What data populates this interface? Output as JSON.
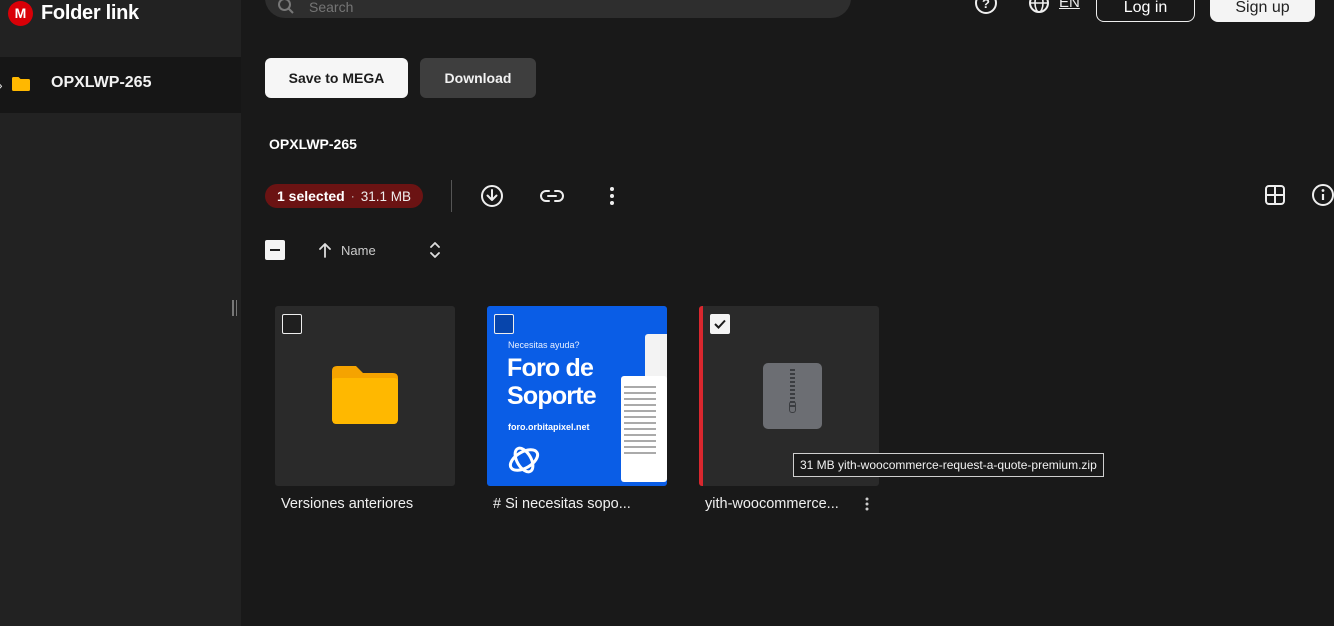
{
  "app": {
    "title": "Folder link"
  },
  "sidebar": {
    "items": [
      {
        "label": "OPXLWP-265"
      }
    ]
  },
  "search": {
    "placeholder": "Search"
  },
  "header": {
    "language": "EN",
    "login_label": "Log in",
    "signup_label": "Sign up"
  },
  "actions": {
    "save_label": "Save to MEGA",
    "download_label": "Download"
  },
  "folder": {
    "title": "OPXLWP-265"
  },
  "selection": {
    "count_label": "1 selected",
    "separator": "·",
    "size": "31.1 MB"
  },
  "sort": {
    "label": "Name"
  },
  "files": [
    {
      "name": "Versiones anteriores",
      "type": "folder",
      "checked": false
    },
    {
      "name": "# Si necesitas sopo...",
      "type": "image",
      "checked": false,
      "thumb": {
        "small": "Necesitas ayuda?",
        "big_line1": "Foro de",
        "big_line2": "Soporte",
        "url": "foro.orbitapixel.net"
      }
    },
    {
      "name": "yith-woocommerce...",
      "type": "zip",
      "checked": true
    }
  ],
  "tooltip": {
    "text": "31 MB yith-woocommerce-request-a-quote-premium.zip"
  },
  "colors": {
    "accent": "#d9272e",
    "badge": "#6b1313",
    "folder": "#ffb800",
    "promo": "#0a5de6"
  }
}
